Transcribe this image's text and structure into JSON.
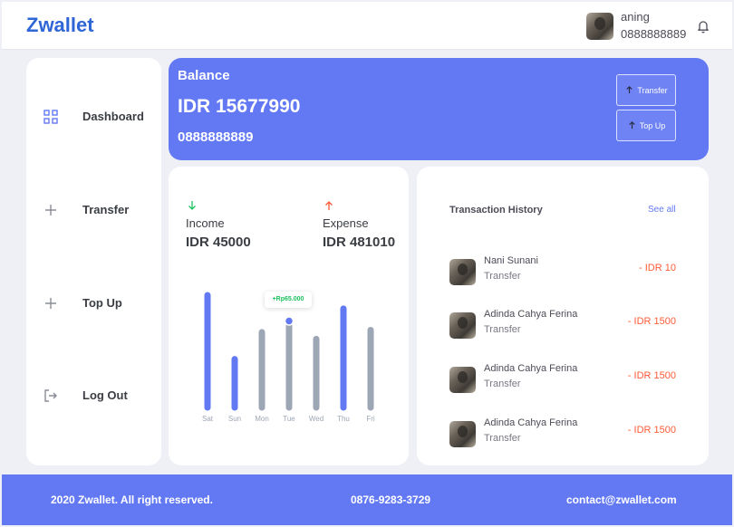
{
  "header": {
    "logo": "Zwallet",
    "user_name": "aning",
    "user_phone": "0888888889",
    "icons": {
      "notification": "bell-icon"
    }
  },
  "sidebar": {
    "items": [
      {
        "label": "Dashboard",
        "icon": "grid-icon",
        "active": true
      },
      {
        "label": "Transfer",
        "icon": "plus-icon"
      },
      {
        "label": "Top Up",
        "icon": "plus-icon"
      },
      {
        "label": "Log Out",
        "icon": "logout-icon"
      }
    ]
  },
  "balance": {
    "title": "Balance",
    "amount": "IDR 15677990",
    "phone": "0888888889",
    "transfer_label": "Transfer",
    "topup_label": "Top Up"
  },
  "stats": {
    "income_label": "Income",
    "income_value": "IDR 45000",
    "expense_label": "Expense",
    "expense_value": "IDR 481010",
    "tooltip": "+Rp65.000"
  },
  "chart_data": {
    "type": "bar",
    "categories": [
      "Sat",
      "Sun",
      "Mon",
      "Tue",
      "Wed",
      "Thu",
      "Fri"
    ],
    "values": [
      100,
      43,
      67,
      73,
      61,
      88,
      69
    ],
    "highlight": [
      true,
      true,
      false,
      false,
      false,
      true,
      false
    ],
    "selected_index": 3,
    "colors": {
      "highlight": "#6379f4",
      "normal": "#9da6b5",
      "marker": "#6379f4"
    },
    "title": "",
    "xlabel": "",
    "ylabel": ""
  },
  "history": {
    "title": "Transaction History",
    "see_all": "See all",
    "transactions": [
      {
        "name": "Nani Sunani",
        "type": "Transfer",
        "amount": "- IDR 10"
      },
      {
        "name": "Adinda Cahya Ferina",
        "type": "Transfer",
        "amount": "- IDR 1500"
      },
      {
        "name": "Adinda Cahya Ferina",
        "type": "Transfer",
        "amount": "- IDR 1500"
      },
      {
        "name": "Adinda Cahya Ferina",
        "type": "Transfer",
        "amount": "- IDR 1500"
      }
    ]
  },
  "footer": {
    "copyright": "2020 Zwallet. All right reserved.",
    "phone": "0876-9283-3729",
    "email": "contact@zwallet.com"
  },
  "colors": {
    "primary": "#6379f4",
    "logo": "#2f66d6",
    "income": "#1ec15f",
    "expense": "#ff5b37"
  }
}
